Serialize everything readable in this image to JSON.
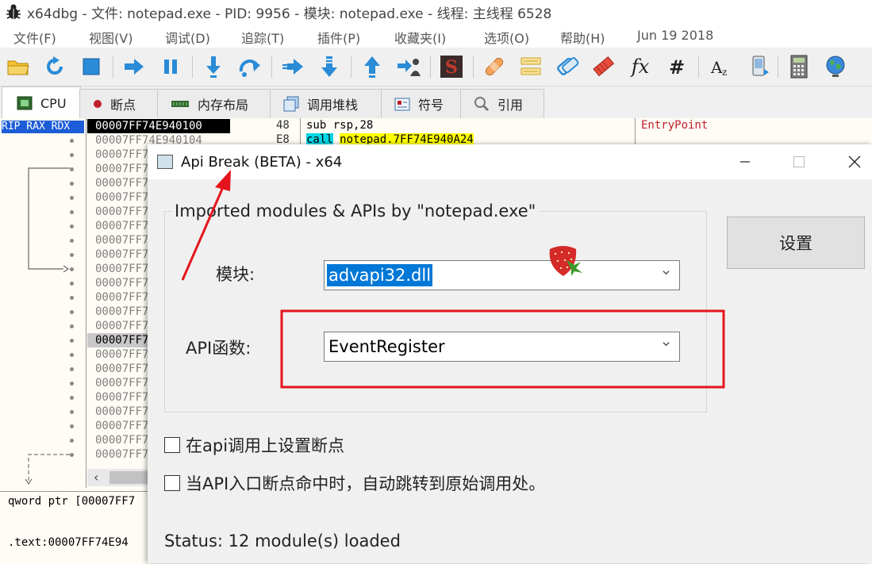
{
  "window": {
    "title": "x64dbg - 文件: notepad.exe - PID: 9956 - 模块: notepad.exe - 线程: 主线程 6528",
    "icon": "bug-icon"
  },
  "menu": {
    "items": [
      "文件(F)",
      "视图(V)",
      "调试(D)",
      "追踪(T)",
      "插件(P)",
      "收藏夹(I)",
      "选项(O)",
      "帮助(H)"
    ],
    "date": "Jun 19 2018"
  },
  "toolbar": {
    "icons": [
      "open-folder-icon",
      "restart-icon",
      "stop-icon",
      "run-icon",
      "pause-icon",
      "step-into-icon",
      "step-over-icon",
      "trace-into-icon",
      "trace-over-icon",
      "execute-till-return-icon",
      "run-to-user-code-icon",
      "scylla-icon",
      "patch-icon",
      "comment-icon",
      "label-icon",
      "bookmark-icon",
      "function-icon",
      "hash-icon",
      "font-icon",
      "device-icon",
      "calculator-icon",
      "globe-icon"
    ]
  },
  "tabs": [
    {
      "label": "CPU",
      "icon": "cpu-icon"
    },
    {
      "label": "断点",
      "icon": "breakpoint-icon"
    },
    {
      "label": "内存布局",
      "icon": "memory-icon"
    },
    {
      "label": "调用堆栈",
      "icon": "call-stack-icon"
    },
    {
      "label": "符号",
      "icon": "symbol-icon"
    },
    {
      "label": "引用",
      "icon": "reference-icon"
    }
  ],
  "cpu": {
    "regs_label": "RIP RAX RDX",
    "rows": [
      {
        "addr": "00007FF74E940100",
        "bytes": "48",
        "instr_mnemonic": "sub",
        "instr_operands": "rsp,28",
        "comment": "EntryPoint",
        "selected": true
      },
      {
        "addr": "00007FF74E940104",
        "bytes": "E8",
        "instr_mnemonic": "call",
        "instr_operands": "notepad.7FF74E940A24",
        "comment": ""
      },
      {
        "addr": "00007FF7",
        "bytes": "",
        "instr_mnemonic": "",
        "instr_operands": "",
        "comment": ""
      },
      {
        "addr": "00007FF7",
        "bytes": "",
        "instr_mnemonic": "",
        "instr_operands": "",
        "comment": ""
      },
      {
        "addr": "00007FF7",
        "bytes": "",
        "instr_mnemonic": "",
        "instr_operands": "",
        "comment": ""
      },
      {
        "addr": "00007FF7",
        "bytes": "",
        "instr_mnemonic": "",
        "instr_operands": "",
        "comment": ""
      },
      {
        "addr": "00007FF7",
        "bytes": "",
        "instr_mnemonic": "",
        "instr_operands": "",
        "comment": ""
      },
      {
        "addr": "00007FF7",
        "bytes": "",
        "instr_mnemonic": "",
        "instr_operands": "",
        "comment": ""
      },
      {
        "addr": "00007FF7",
        "bytes": "",
        "instr_mnemonic": "",
        "instr_operands": "",
        "comment": ""
      },
      {
        "addr": "00007FF7",
        "bytes": "",
        "instr_mnemonic": "",
        "instr_operands": "",
        "comment": ""
      },
      {
        "addr": "00007FF7",
        "bytes": "",
        "instr_mnemonic": "",
        "instr_operands": "",
        "comment": ""
      },
      {
        "addr": "00007FF7",
        "bytes": "",
        "instr_mnemonic": "",
        "instr_operands": "",
        "comment": ""
      },
      {
        "addr": "00007FF7",
        "bytes": "",
        "instr_mnemonic": "",
        "instr_operands": "",
        "comment": ""
      },
      {
        "addr": "00007FF7",
        "bytes": "",
        "instr_mnemonic": "",
        "instr_operands": "",
        "comment": ""
      },
      {
        "addr": "00007FF7",
        "bytes": "",
        "instr_mnemonic": "",
        "instr_operands": "",
        "comment": ""
      },
      {
        "addr": "00007FF7",
        "bytes": "",
        "instr_mnemonic": "",
        "instr_operands": "",
        "comment": "",
        "highlight": true
      },
      {
        "addr": "00007FF7",
        "bytes": "",
        "instr_mnemonic": "",
        "instr_operands": "",
        "comment": ""
      },
      {
        "addr": "00007FF7",
        "bytes": "",
        "instr_mnemonic": "",
        "instr_operands": "",
        "comment": ""
      },
      {
        "addr": "00007FF7",
        "bytes": "",
        "instr_mnemonic": "",
        "instr_operands": "",
        "comment": ""
      },
      {
        "addr": "00007FF7",
        "bytes": "",
        "instr_mnemonic": "",
        "instr_operands": "",
        "comment": ""
      },
      {
        "addr": "00007FF7",
        "bytes": "",
        "instr_mnemonic": "",
        "instr_operands": "",
        "comment": ""
      },
      {
        "addr": "00007FF7",
        "bytes": "",
        "instr_mnemonic": "",
        "instr_operands": "",
        "comment": ""
      },
      {
        "addr": "00007FF7",
        "bytes": "",
        "instr_mnemonic": "",
        "instr_operands": "",
        "comment": ""
      },
      {
        "addr": "00007FF7",
        "bytes": "",
        "instr_mnemonic": "",
        "instr_operands": "",
        "comment": ""
      }
    ],
    "info_line1": "qword ptr [00007FF7",
    "info_line2": ".text:00007FF74E94"
  },
  "dialog": {
    "title": "Api Break (BETA) - x64",
    "group_title": "Imported modules & APIs by \"notepad.exe\"",
    "module_label": "模块:",
    "module_value": "advapi32.dll",
    "api_label": "API函数:",
    "api_value": "EventRegister",
    "settings_button": "设置",
    "checkbox1": "在api调用上设置断点",
    "checkbox2": "当API入口断点命中时，自动跳转到原始调用处。",
    "checkbox1_checked": false,
    "checkbox2_checked": false,
    "status": "Status: 12 module(s) loaded"
  },
  "colors": {
    "annotation_red": "#e5141c",
    "selection_blue": "#0078d7",
    "register_label_bg": "#1c5cd6",
    "call_highlight": "#00d7e6",
    "operand_highlight": "#ffff00"
  }
}
